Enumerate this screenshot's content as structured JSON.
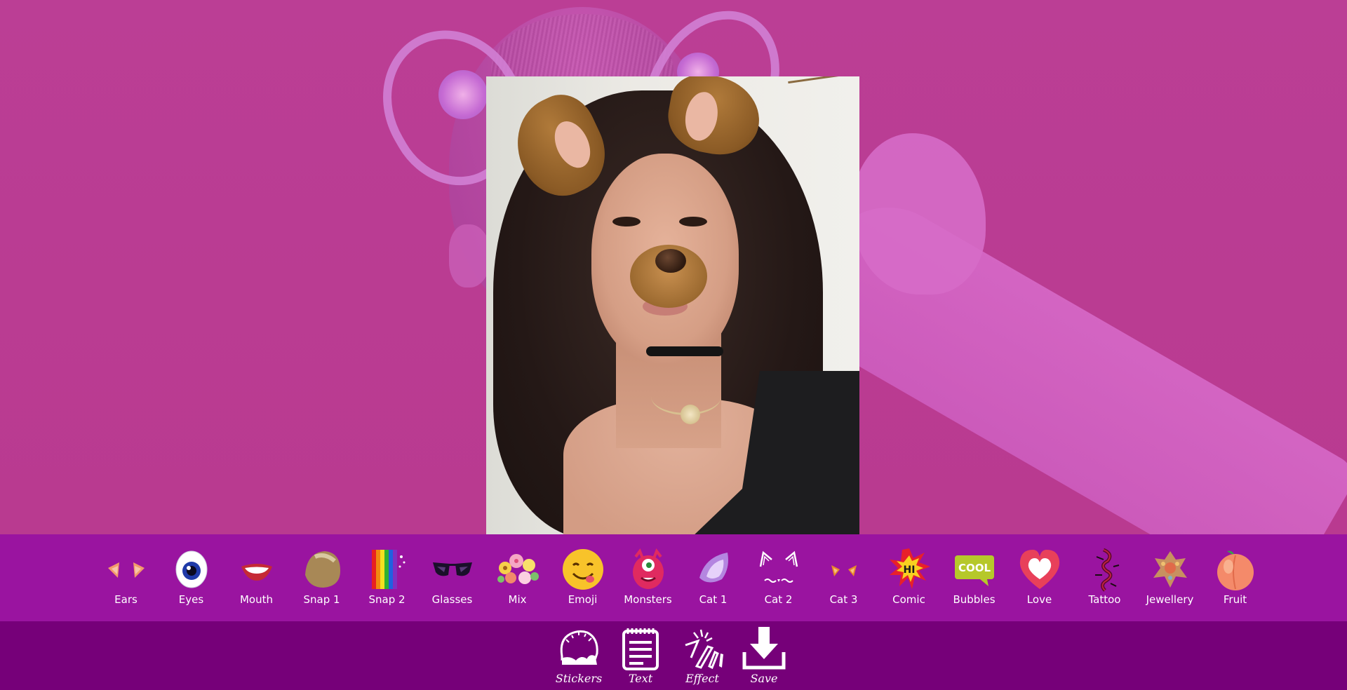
{
  "categories": [
    {
      "label": "Ears",
      "icon": "cat-ears-icon"
    },
    {
      "label": "Eyes",
      "icon": "eyeball-icon"
    },
    {
      "label": "Mouth",
      "icon": "mouth-icon"
    },
    {
      "label": "Snap 1",
      "icon": "dog-face-icon"
    },
    {
      "label": "Snap 2",
      "icon": "rainbow-icon"
    },
    {
      "label": "Glasses",
      "icon": "sunglasses-icon"
    },
    {
      "label": "Mix",
      "icon": "flower-crown-icon"
    },
    {
      "label": "Emoji",
      "icon": "emoji-icon"
    },
    {
      "label": "Monsters",
      "icon": "monster-icon"
    },
    {
      "label": "Cat 1",
      "icon": "cat-ear-icon"
    },
    {
      "label": "Cat 2",
      "icon": "cat-whiskers-icon"
    },
    {
      "label": "Cat 3",
      "icon": "small-cat-ears-icon"
    },
    {
      "label": "Comic",
      "icon": "comic-hi-icon"
    },
    {
      "label": "Bubbles",
      "icon": "cool-bubble-icon"
    },
    {
      "label": "Love",
      "icon": "heart-icon"
    },
    {
      "label": "Tattoo",
      "icon": "dragon-tattoo-icon"
    },
    {
      "label": "Jewellery",
      "icon": "jewellery-icon"
    },
    {
      "label": "Fruit",
      "icon": "peach-icon"
    }
  ],
  "comic_text": "HI",
  "bubble_text": "COOL",
  "toolbar": [
    {
      "label": "Stickers",
      "icon": "stickers-icon"
    },
    {
      "label": "Text",
      "icon": "notepad-icon"
    },
    {
      "label": "Effect",
      "icon": "magic-wand-icon"
    },
    {
      "label": "Save",
      "icon": "download-icon"
    }
  ],
  "colors": {
    "background": "#b93d92",
    "category_bar": "#9a14a0",
    "toolbar": "#760079"
  }
}
